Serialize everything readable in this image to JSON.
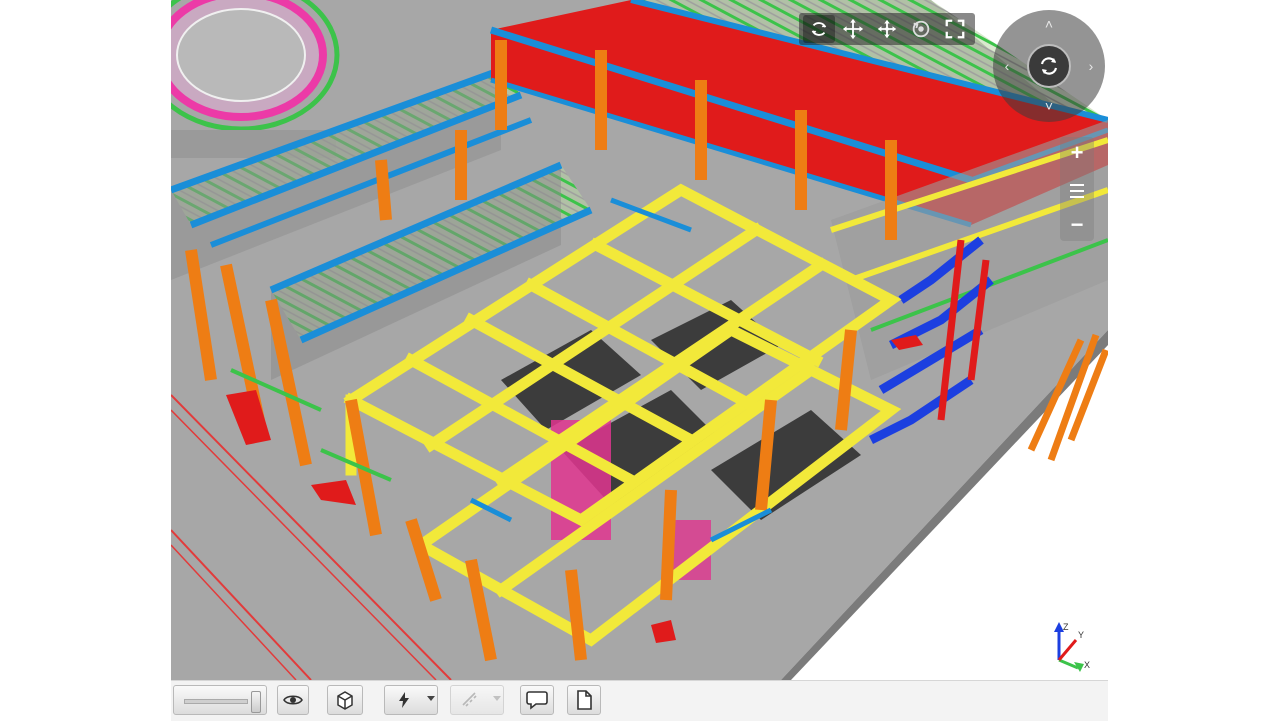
{
  "app": {
    "viewer_label": "3D model viewer"
  },
  "navigation": {
    "tools": [
      {
        "name": "orbit-tool",
        "icon": "orbit-icon",
        "active": true
      },
      {
        "name": "pan-tool",
        "icon": "pan-icon",
        "active": false
      },
      {
        "name": "move-tool",
        "icon": "move-icon",
        "active": false
      },
      {
        "name": "look-around-tool",
        "icon": "look-icon",
        "active": false
      },
      {
        "name": "fullscreen-tool",
        "icon": "fullscreen-icon",
        "active": false
      }
    ],
    "view_wheel": {
      "up": "˄",
      "down": "˅",
      "left": "‹",
      "right": "›"
    },
    "zoom": {
      "in_label": "+",
      "out_label": "−"
    }
  },
  "axis": {
    "x": "X",
    "y": "Y",
    "z": "Z"
  },
  "toolbar": {
    "buttons": [
      {
        "name": "section-slider",
        "icon": "slider-icon"
      },
      {
        "name": "visibility-button",
        "icon": "eye-icon"
      },
      {
        "name": "model-box-button",
        "icon": "cube-icon"
      },
      {
        "name": "lightning-button",
        "icon": "lightning-icon"
      },
      {
        "name": "measure-button",
        "icon": "measure-icon",
        "disabled": true
      },
      {
        "name": "comment-button",
        "icon": "speech-bubble-icon"
      },
      {
        "name": "document-button",
        "icon": "document-icon"
      }
    ]
  },
  "colors": {
    "ground": "#a7a7a7",
    "steel_yellow": "#f2e93a",
    "column_orange": "#ee7d14",
    "beam_blue": "#1a8ed8",
    "pipe_green": "#3cc34a",
    "panel_red": "#e01b1b",
    "pipe_magenta": "#e0358f",
    "duct_blue": "#1c3fe0"
  }
}
